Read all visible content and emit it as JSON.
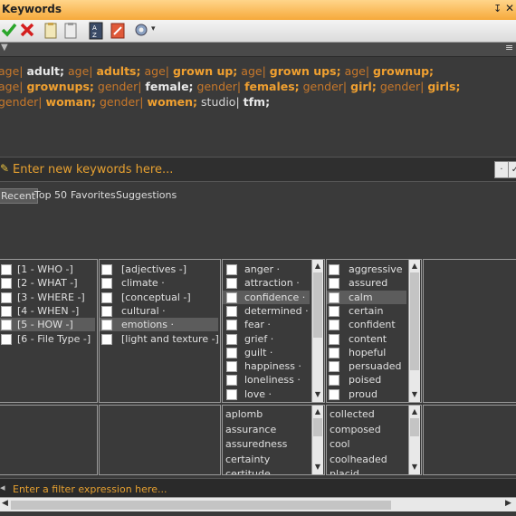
{
  "window": {
    "title": "Keywords",
    "pin_glyph": "↧",
    "close_glyph": "✕"
  },
  "toolbar": {
    "icons": [
      "checkmark-icon",
      "delete-icon",
      "paste-icon",
      "clipboard-icon",
      "sort-icon",
      "tag-icon",
      "settings-icon"
    ],
    "dropdown_glyph": "▾"
  },
  "strip": {
    "left_glyph": "▼",
    "menu_glyph": "≡"
  },
  "keywords": [
    {
      "pre": "age|",
      "main": "adult;",
      "color": "plain"
    },
    {
      "pre": "age|",
      "main": "adults;"
    },
    {
      "pre": "age|",
      "main": "grown up;"
    },
    {
      "pre": "age|",
      "main": "grown ups;"
    },
    {
      "pre": "age|",
      "main": "grownup;"
    },
    {
      "pre": "age|",
      "main": "grownups;"
    },
    {
      "pre": "gender|",
      "main": "female;",
      "color": "plain"
    },
    {
      "pre": "gender|",
      "main": "females;"
    },
    {
      "pre": "gender|",
      "main": "girl;"
    },
    {
      "pre": "gender|",
      "main": "girls;"
    },
    {
      "pre": "gender|",
      "main": "woman;"
    },
    {
      "pre": "gender|",
      "main": "women;"
    },
    {
      "pre": "",
      "main": "studio|",
      "color": "plain-normal"
    },
    {
      "pre": "",
      "main": "tfm;",
      "color": "plain"
    }
  ],
  "enter": {
    "placeholder": "Enter new keywords here...",
    "btn1": "·",
    "btn2": "✓"
  },
  "tabs": [
    {
      "label": "Recent",
      "selected": true
    },
    {
      "label": "Top 50",
      "selected": false
    },
    {
      "label": "Favorites",
      "selected": false
    },
    {
      "label": "Suggestions",
      "selected": false
    }
  ],
  "col1": [
    {
      "label": "[1 - WHO -]",
      "selected": false
    },
    {
      "label": "[2 - WHAT -]",
      "selected": false
    },
    {
      "label": "[3 - WHERE -]",
      "selected": false
    },
    {
      "label": "[4 - WHEN -]",
      "selected": false
    },
    {
      "label": "[5 - HOW -]",
      "selected": true
    },
    {
      "label": "[6 - File Type -]",
      "selected": false
    }
  ],
  "col2": [
    {
      "label": "[adjectives -]",
      "selected": false
    },
    {
      "label": "climate ·",
      "selected": false
    },
    {
      "label": "[conceptual -]",
      "selected": false
    },
    {
      "label": "cultural ·",
      "selected": false
    },
    {
      "label": "emotions ·",
      "selected": true
    },
    {
      "label": "[light and texture -]",
      "selected": false
    }
  ],
  "col3": [
    {
      "label": "anger ·",
      "selected": false
    },
    {
      "label": "attraction ·",
      "selected": false
    },
    {
      "label": "confidence ·",
      "selected": true
    },
    {
      "label": "determined ·",
      "selected": false
    },
    {
      "label": "fear ·",
      "selected": false
    },
    {
      "label": "grief ·",
      "selected": false
    },
    {
      "label": "guilt ·",
      "selected": false
    },
    {
      "label": "happiness ·",
      "selected": false
    },
    {
      "label": "loneliness ·",
      "selected": false
    },
    {
      "label": "love ·",
      "selected": false
    }
  ],
  "col4": [
    {
      "label": "aggressive",
      "selected": false
    },
    {
      "label": "assured",
      "selected": false
    },
    {
      "label": "calm",
      "selected": true
    },
    {
      "label": "certain",
      "selected": false
    },
    {
      "label": "confident",
      "selected": false
    },
    {
      "label": "content",
      "selected": false
    },
    {
      "label": "hopeful",
      "selected": false
    },
    {
      "label": "persuaded",
      "selected": false
    },
    {
      "label": "poised",
      "selected": false
    },
    {
      "label": "proud",
      "selected": false
    }
  ],
  "lower3": [
    "aplomb",
    "assurance",
    "assuredness",
    "certainty",
    "certitude"
  ],
  "lower4": [
    "collected",
    "composed",
    "cool",
    "coolheaded",
    "placid"
  ],
  "filter": {
    "placeholder": "Enter a filter expression here..."
  },
  "scroll": {
    "up": "▲",
    "down": "▼",
    "left": "◀",
    "right": "▶"
  }
}
